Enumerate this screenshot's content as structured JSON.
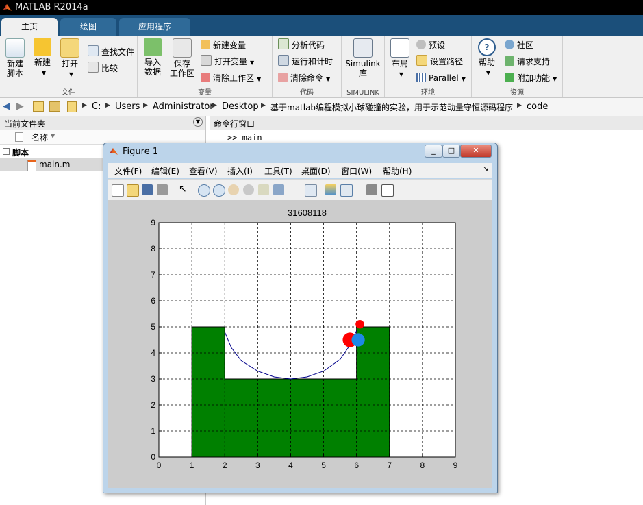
{
  "app": {
    "title": "MATLAB R2014a"
  },
  "tabs": [
    "主页",
    "绘图",
    "应用程序"
  ],
  "ribbon": {
    "groups": [
      {
        "label": "文件"
      },
      {
        "label": "变量"
      },
      {
        "label": "代码"
      },
      {
        "label": "SIMULINK"
      },
      {
        "label": "环境"
      },
      {
        "label": "资源"
      }
    ],
    "new_script": [
      "新建",
      "脚本"
    ],
    "new": "新建",
    "open": "打开",
    "find_files": "查找文件",
    "compare": "比较",
    "import": [
      "导入",
      "数据"
    ],
    "save_ws": [
      "保存",
      "工作区"
    ],
    "new_var": "新建变量",
    "open_var": "打开变量",
    "clear_ws": "清除工作区",
    "analyze": "分析代码",
    "run_time": "运行和计时",
    "clear_cmd": "清除命令",
    "simulink": [
      "Simulink",
      "库"
    ],
    "layout": "布局",
    "prefs": "预设",
    "set_path": "设置路径",
    "parallel": "Parallel",
    "help": "帮助",
    "community": "社区",
    "support": "请求支持",
    "addons": "附加功能"
  },
  "address": [
    "C:",
    "Users",
    "Administrator",
    "Desktop",
    "基于matlab编程模拟小球碰撞的实验，用于示范动量守恒源码程序",
    "code"
  ],
  "left_panel": {
    "title": "当前文件夹",
    "col_name": "名称",
    "group": "脚本",
    "file": "main.m"
  },
  "right_panel": {
    "title": "命令行窗口",
    "command": ">> main"
  },
  "figure": {
    "title": "Figure 1",
    "menus": [
      "文件(F)",
      "编辑(E)",
      "查看(V)",
      "插入(I)",
      "工具(T)",
      "桌面(D)",
      "窗口(W)",
      "帮助(H)"
    ]
  },
  "chart_data": {
    "type": "area",
    "title": "31608118",
    "xlabel": "",
    "ylabel": "",
    "xlim": [
      0,
      9
    ],
    "ylim": [
      0,
      9
    ],
    "xticks": [
      0,
      1,
      2,
      3,
      4,
      5,
      6,
      7,
      8,
      9
    ],
    "yticks": [
      0,
      1,
      2,
      3,
      4,
      5,
      6,
      7,
      8,
      9
    ],
    "grid": true,
    "ground_color": "#008000",
    "ground_outline": [
      [
        1,
        0
      ],
      [
        1,
        5
      ],
      [
        2,
        5
      ],
      [
        2,
        3
      ],
      [
        6,
        3
      ],
      [
        6,
        5
      ],
      [
        7,
        5
      ],
      [
        7,
        0
      ]
    ],
    "trajectory_color": "#00008b",
    "trajectory": [
      [
        2,
        4.8
      ],
      [
        2.2,
        4.2
      ],
      [
        2.5,
        3.7
      ],
      [
        3,
        3.3
      ],
      [
        3.5,
        3.08
      ],
      [
        4,
        3.0
      ],
      [
        4.5,
        3.08
      ],
      [
        5,
        3.3
      ],
      [
        5.5,
        3.75
      ],
      [
        5.8,
        4.3
      ],
      [
        6,
        4.85
      ]
    ],
    "balls": [
      {
        "x": 5.8,
        "y": 4.5,
        "r": 0.22,
        "color": "#ff0000"
      },
      {
        "x": 6.05,
        "y": 4.5,
        "r": 0.2,
        "color": "#1e88e5"
      },
      {
        "x": 6.1,
        "y": 5.1,
        "r": 0.13,
        "color": "#ff0000"
      }
    ]
  }
}
